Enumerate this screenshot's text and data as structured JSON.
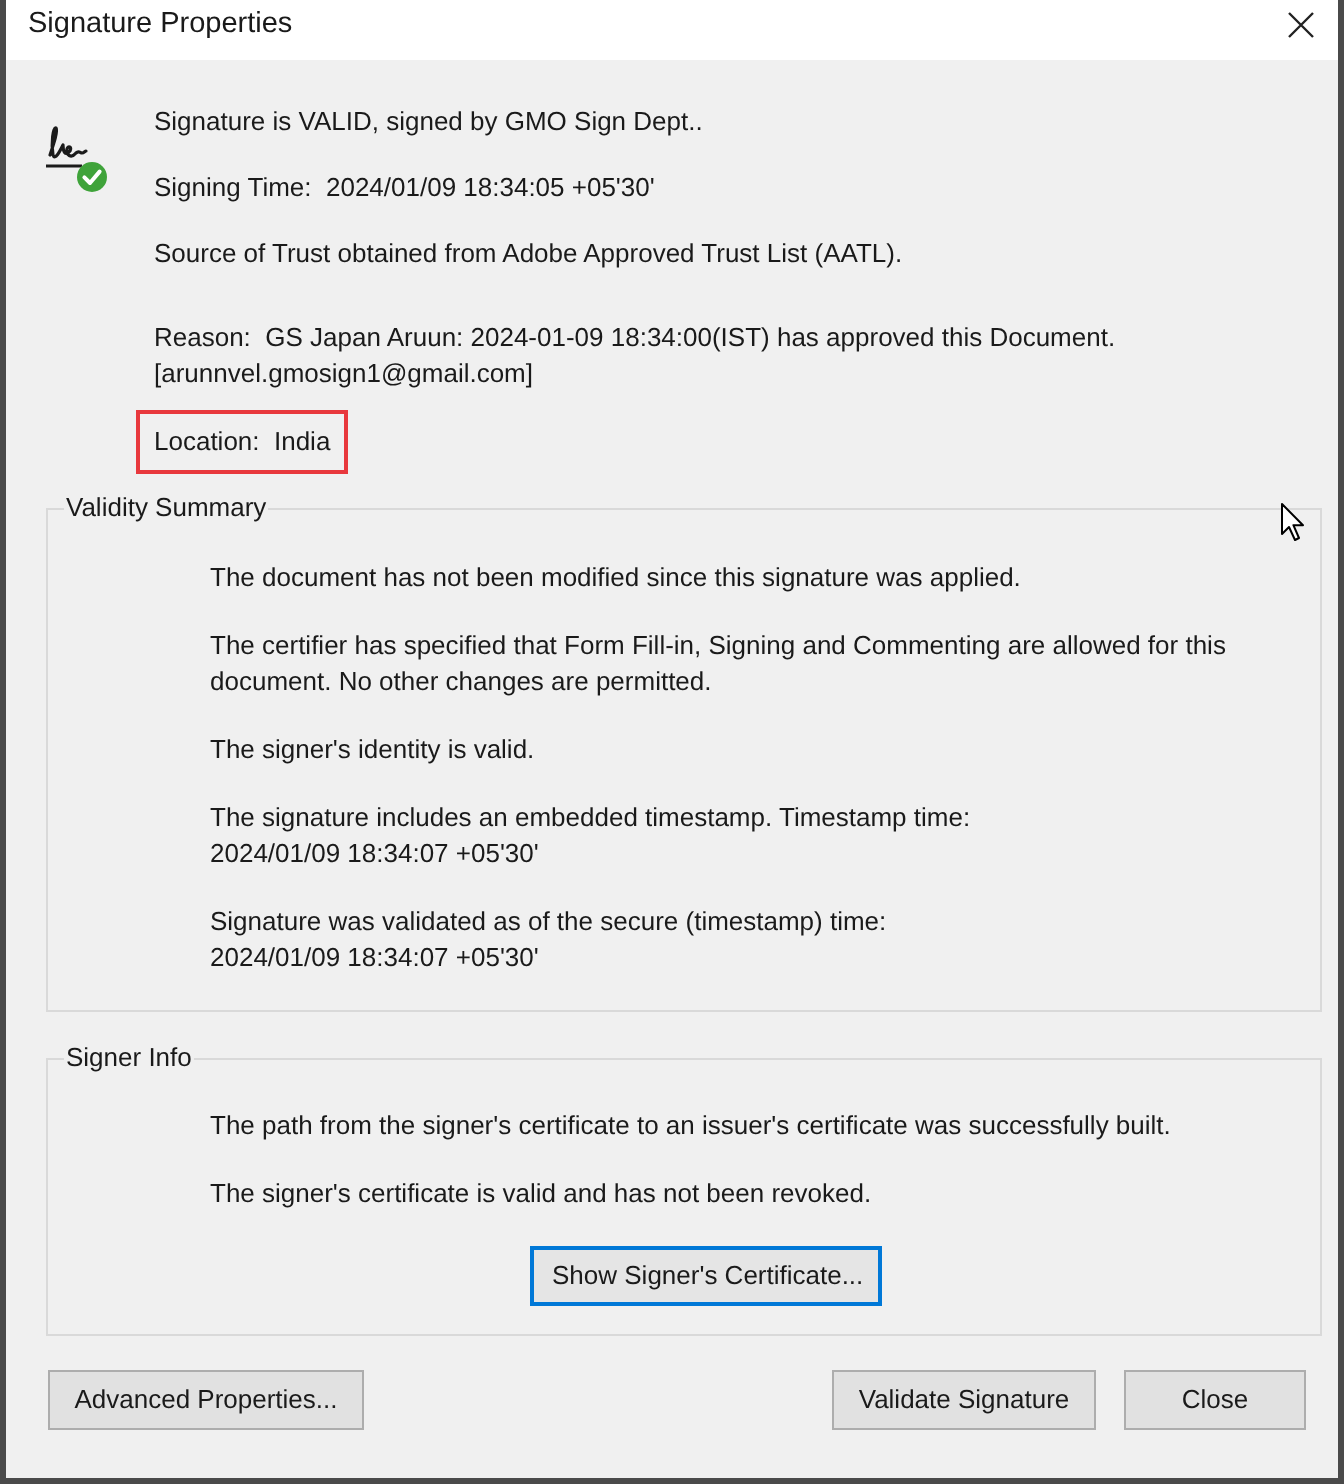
{
  "window": {
    "title": "Signature Properties"
  },
  "signature": {
    "valid": true,
    "lines": [
      {
        "text": "Signature is VALID, signed by GMO Sign Dept..",
        "highlighted": false
      },
      {
        "text": "Signing Time:  2024/01/09 18:34:05 +05'30'",
        "highlighted": false
      },
      {
        "text": "Source of Trust obtained from Adobe Approved Trust List (AATL).",
        "highlighted": false
      }
    ],
    "details": [
      {
        "text": "Reason:  GS Japan Aruun: 2024-01-09 18:34:00(IST) has approved this Document. [arunnvel.gmosign1@gmail.com]",
        "highlighted": false
      },
      {
        "text": "Location:  India",
        "highlighted": true
      }
    ]
  },
  "validity_summary": {
    "title": "Validity Summary",
    "messages": [
      "The document has not been modified since this signature was applied.",
      "The certifier has specified that Form Fill-in, Signing and Commenting are allowed for this document. No other changes are permitted.",
      "The signer's identity is valid.",
      "The signature includes an embedded timestamp. Timestamp time:\n2024/01/09 18:34:07 +05'30'",
      "Signature was validated as of the secure (timestamp) time:\n2024/01/09 18:34:07 +05'30'"
    ]
  },
  "signer_info": {
    "title": "Signer Info",
    "messages": [
      "The path from the signer's certificate to an issuer's certificate was successfully built.",
      "The signer's certificate is valid and has not been revoked."
    ],
    "button": {
      "label": "Show Signer's Certificate...",
      "focused": true
    }
  },
  "buttons": [
    {
      "label": "Advanced Properties...",
      "focused": false
    },
    {
      "label": "Validate Signature",
      "focused": false
    },
    {
      "label": "Close",
      "focused": false
    }
  ]
}
